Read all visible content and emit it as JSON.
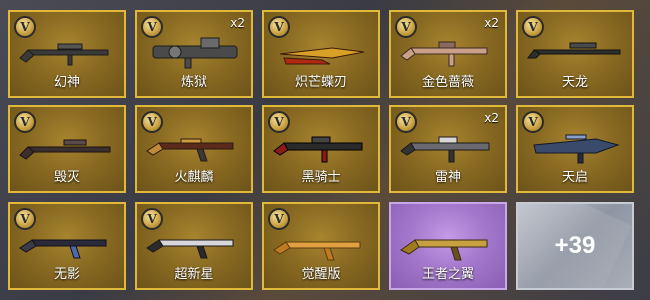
{
  "badge_letter": "V",
  "cards": [
    {
      "name": "幻神",
      "count": "",
      "style": "gold",
      "weapon": "sniper-rifle"
    },
    {
      "name": "炼狱",
      "count": "x2",
      "style": "gold",
      "weapon": "gatling-gun"
    },
    {
      "name": "炽芒蝶刃",
      "count": "",
      "style": "gold",
      "weapon": "butterfly-knife"
    },
    {
      "name": "金色蔷薇",
      "count": "x2",
      "style": "gold",
      "weapon": "assault-rifle"
    },
    {
      "name": "天龙",
      "count": "",
      "style": "gold",
      "weapon": "sniper-rifle"
    },
    {
      "name": "毁灭",
      "count": "",
      "style": "gold",
      "weapon": "sniper-rifle"
    },
    {
      "name": "火麒麟",
      "count": "",
      "style": "gold",
      "weapon": "ak-rifle"
    },
    {
      "name": "黑骑士",
      "count": "",
      "style": "gold",
      "weapon": "m4-rifle"
    },
    {
      "name": "雷神",
      "count": "x2",
      "style": "gold",
      "weapon": "m4-rifle"
    },
    {
      "name": "天启",
      "count": "",
      "style": "gold",
      "weapon": "futuristic-rifle"
    },
    {
      "name": "无影",
      "count": "",
      "style": "gold",
      "weapon": "ak-rifle"
    },
    {
      "name": "超新星",
      "count": "",
      "style": "gold",
      "weapon": "ak-rifle"
    },
    {
      "name": "觉醒版",
      "count": "",
      "style": "gold",
      "weapon": "ak-rifle"
    },
    {
      "name": "王者之翼",
      "count": "",
      "style": "purple",
      "weapon": "ak-rifle"
    }
  ],
  "more": {
    "label": "+39"
  },
  "colors": {
    "gold_border": "#e0b93a",
    "gold_bg": "#8a6b22",
    "purple_bg": "#a478cc",
    "more_bg": "#9aa0ab"
  }
}
